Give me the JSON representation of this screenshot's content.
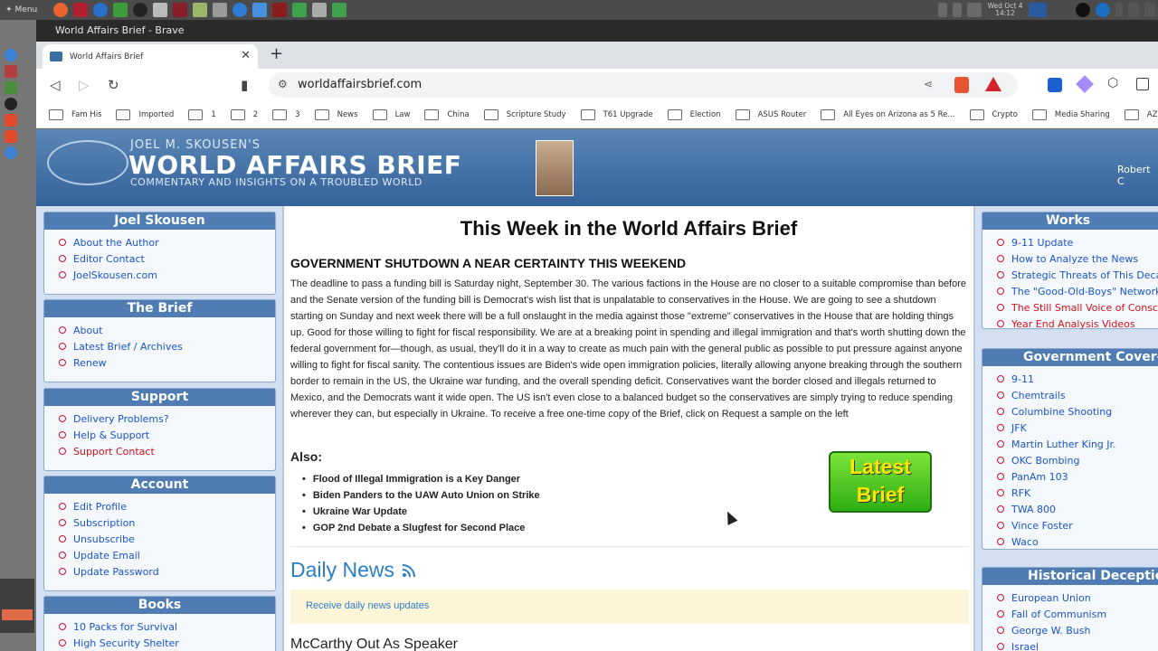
{
  "os": {
    "menu_label": "Menu",
    "clock_day": "Wed Oct 4",
    "clock_time": "14:12"
  },
  "window": {
    "title": "World Affairs Brief - Brave"
  },
  "tab": {
    "title": "World Affairs Brief"
  },
  "omnibox": {
    "url": "worldaffairsbrief.com"
  },
  "bookmarks": [
    "Fam His",
    "Imported",
    "1",
    "2",
    "3",
    "News",
    "Law",
    "China",
    "Scripture Study",
    "T61 Upgrade",
    "Election",
    "ASUS Router",
    "All Eyes on Arizona as 5 Re...",
    "Crypto",
    "Media Sharing",
    "AZ MVD"
  ],
  "banner": {
    "top_line": "JOEL M. SKOUSEN'S",
    "title": "WORLD AFFAIRS BRIEF",
    "tagline": "COMMENTARY AND INSIGHTS ON A TROUBLED WORLD",
    "user": "Robert C"
  },
  "left": {
    "joel": {
      "title": "Joel Skousen",
      "items": [
        "About the Author",
        "Editor Contact",
        "JoelSkousen.com"
      ]
    },
    "brief": {
      "title": "The Brief",
      "items": [
        "About",
        "Latest Brief / Archives",
        "Renew"
      ]
    },
    "support": {
      "title": "Support",
      "items": [
        "Delivery Problems?",
        "Help & Support",
        "Support Contact"
      ]
    },
    "account": {
      "title": "Account",
      "items": [
        "Edit Profile",
        "Subscription",
        "Unsubscribe",
        "Update Email",
        "Update Password"
      ]
    },
    "books": {
      "title": "Books",
      "items": [
        "10 Packs for Survival",
        "High Security Shelter"
      ]
    }
  },
  "right": {
    "works": {
      "title": "Works",
      "items": [
        "9-11 Update",
        "How to Analyze the News",
        "Strategic Threats of This Decade",
        "The \"Good-Old-Boys\" Network",
        "The Still Small Voice of Conscience",
        "Year End Analysis Videos"
      ]
    },
    "coverups": {
      "title": "Government Cover-ups",
      "items": [
        "9-11",
        "Chemtrails",
        "Columbine Shooting",
        "JFK",
        "Martin Luther King Jr.",
        "OKC Bombing",
        "PanAm 103",
        "RFK",
        "TWA 800",
        "Vince Foster",
        "Waco"
      ]
    },
    "deception": {
      "title": "Historical Deception",
      "items": [
        "European Union",
        "Fall of Communism",
        "George W. Bush",
        "Israel"
      ]
    }
  },
  "main": {
    "heading": "This Week in the World Affairs Brief",
    "subheading": "GOVERNMENT SHUTDOWN A NEAR CERTAINTY THIS WEEKEND",
    "body": "The deadline to pass a funding bill is Saturday night, September 30. The various factions in the House are no closer to a suitable compromise than before and the Senate version of the funding bill is Democrat's wish list that is unpalatable to conservatives in the House. We are going to see a shutdown starting on Sunday and next week there will be a full onslaught in the media against those \"extreme\" conservatives in the House that are holding things up. Good for those willing to fight for fiscal responsibility. We are at a breaking point in spending and illegal immigration and that's worth shutting down the federal government for—though, as usual, they'll do it in a way to create as much pain with the general public as possible to put pressure against anyone willing to fight for fiscal sanity. The contentious issues are Biden's wide open immigration policies, literally allowing anyone breaking through the southern border to remain in the US, the Ukraine war funding, and the overall spending deficit. Conservatives want the border closed and illegals returned to Mexico, and the Democrats want it wide open. The US isn't even close to a balanced budget so the conservatives are simply trying to reduce spending wherever they can, but especially in Ukraine. To receive a free one-time copy of the Brief, click on Request a sample on the left",
    "also_label": "Also:",
    "also_items": [
      "Flood of Illegal Immigration is a Key Danger",
      "Biden Panders to the UAW Auto Union on Strike",
      "Ukraine War Update",
      "GOP 2nd Debate a Slugfest for Second Place"
    ],
    "latest_line1": "Latest",
    "latest_line2": "Brief",
    "daily_news": "Daily News",
    "daily_updates": "Receive daily news updates",
    "headline": "McCarthy Out As Speaker"
  }
}
